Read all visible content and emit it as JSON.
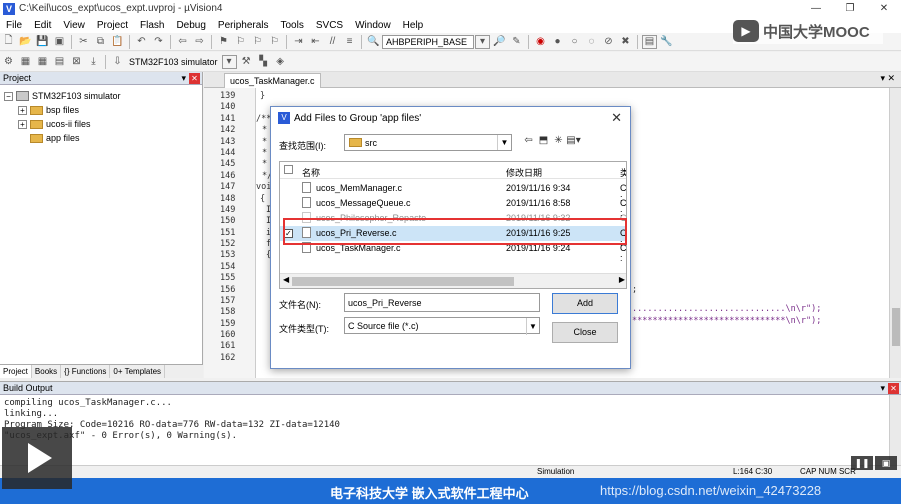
{
  "window": {
    "title": "C:\\Keil\\ucos_expt\\ucos_expt.uvproj - µVision4",
    "app_icon": "V",
    "controls": [
      "—",
      "❐",
      "✕"
    ]
  },
  "menu": [
    "File",
    "Edit",
    "View",
    "Project",
    "Flash",
    "Debug",
    "Peripherals",
    "Tools",
    "SVCS",
    "Window",
    "Help"
  ],
  "toolbar1": {
    "target_combo": "AHBPERIPH_BASE"
  },
  "toolbar2": {
    "target_select": "STM32F103 simulator"
  },
  "mooc_logo": {
    "text": "中国大学MOOC"
  },
  "project_panel": {
    "title": "Project",
    "tree": [
      {
        "label": "STM32F103 simulator",
        "level": 0,
        "type": "target",
        "expand": "−"
      },
      {
        "label": "bsp files",
        "level": 1,
        "type": "folder",
        "expand": "+"
      },
      {
        "label": "ucos-ii files",
        "level": 1,
        "type": "folder",
        "expand": "+"
      },
      {
        "label": "app files",
        "level": 1,
        "type": "folder",
        "expand": ""
      }
    ],
    "tabs": [
      "Project",
      "Books",
      "{} Functions",
      "0+ Templates"
    ]
  },
  "editor": {
    "tab_label": "ucos_TaskManager.c",
    "line_numbers": [
      "139",
      "140",
      "141",
      "142",
      "143",
      "144",
      "145",
      "146",
      "147",
      "148",
      "149",
      "150",
      "151",
      "152",
      "153",
      "154",
      "155",
      "156",
      "157",
      "158",
      "159",
      "160",
      "161",
      "162"
    ],
    "fragments": {
      "l139": "}",
      "l141": "/**",
      "l142": "*",
      "l143": "*",
      "l144": "*",
      "l145": "*",
      "l146": "*/",
      "l147": "voi",
      "l148": "{",
      "l149": "I",
      "l150": "I",
      "l151": "i",
      "l152": "f",
      "l153": "{",
      "l157": ";",
      "l158": "..............................\\n\\r\");",
      "l159": "******************************\\n\\r\");"
    }
  },
  "dialog": {
    "title": "Add Files to Group 'app files'",
    "look_in_label": "查找范围(I):",
    "look_in_value": "src",
    "columns": {
      "name": "名称",
      "date": "修改日期",
      "type": "类"
    },
    "files": [
      {
        "name": "ucos_MemManager.c",
        "date": "2019/11/16 9:34",
        "type": "C :"
      },
      {
        "name": "ucos_MessageQueue.c",
        "date": "2019/11/16 8:58",
        "type": "C :"
      },
      {
        "name": "ucos_Philosopher_Repasto",
        "date": "2019/11/16 9:32",
        "type": "C :"
      },
      {
        "name": "ucos_Pri_Reverse.c",
        "date": "2019/11/16 9:25",
        "type": "C :"
      },
      {
        "name": "ucos_TaskManager.c",
        "date": "2019/11/16 9:24",
        "type": "C :"
      }
    ],
    "filename_label": "文件名(N):",
    "filename_value": "ucos_Pri_Reverse",
    "filetype_label": "文件类型(T):",
    "filetype_value": "C Source file (*.c)",
    "add_button": "Add",
    "close_button": "Close"
  },
  "build_output": {
    "title": "Build Output",
    "lines": [
      "compiling ucos_TaskManager.c...",
      "linking...",
      "Program Size: Code=10216 RO-data=776 RW-data=132 ZI-data=12140",
      "\"ucos_expt.axf\" - 0 Error(s), 0 Warning(s)."
    ]
  },
  "status_bar": {
    "mode": "Simulation",
    "position": "L:164 C:30",
    "flags": "CAP NUM SCR"
  },
  "video": {
    "banner": "电子科技大学 嵌入式软件工程中心",
    "watermark": "https://blog.csdn.net/weixin_42473228"
  }
}
